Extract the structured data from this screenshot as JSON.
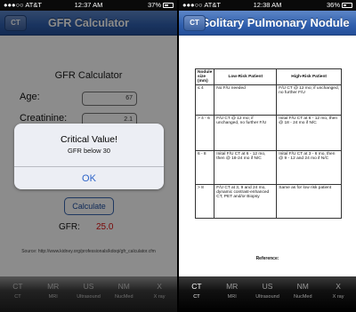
{
  "left": {
    "status": {
      "carrier": "●●●○○ AT&T",
      "time": "12:37 AM",
      "battery": "37%"
    },
    "nav": {
      "back": "CT",
      "title": "GFR Calculator"
    },
    "calc_title": "GFR Calculator",
    "age": {
      "label": "Age:",
      "value": "67"
    },
    "creatinine": {
      "label": "Creatinine:",
      "value": "2.1"
    },
    "calculate_button": "Calculate",
    "gfr": {
      "label": "GFR:",
      "value": "25.0"
    },
    "source": "Source: http://www.kidney.org/professionals/kdoqi/gfr_calculator.cfm",
    "alert": {
      "title": "Critical Value!",
      "message": "GFR below 30",
      "button": "OK"
    },
    "tabs": [
      {
        "abbr": "CT",
        "full": "CT"
      },
      {
        "abbr": "MR",
        "full": "MRI"
      },
      {
        "abbr": "US",
        "full": "Ultrasound"
      },
      {
        "abbr": "NM",
        "full": "NucMed"
      },
      {
        "abbr": "X",
        "full": "X ray"
      }
    ]
  },
  "right": {
    "status": {
      "carrier": "●●●○○ AT&T",
      "time": "12:38 AM",
      "battery": "36%"
    },
    "nav": {
      "back": "CT",
      "title": "Solitary Pulmonary Nodule"
    },
    "table": {
      "headers": [
        "Nodule size (mm)",
        "Low-Risk Patient",
        "High-Risk Patient"
      ],
      "rows": [
        [
          "≤ 4",
          "No F/U needed",
          "F/U CT @ 12 mo; if unchanged, no further F/U"
        ],
        [
          "> 4 - 6",
          "F/U CT @ 12 mo; if unchanged, no further F/U",
          "Inital F/U CT at 6 - 12 mo, then @ 18 - 24 mo if N/C"
        ],
        [
          "6 - 8",
          "Inital F/U CT at 6 - 12 mo, then @ 18-24 mo if N/C",
          "Inital F/U CT at 3 - 6 mo, then @ 9 - 12 and 24 mo if N/C"
        ],
        [
          "> 8",
          "F/U CT at 3, 9 and 24 mo, dynamic contrast-enhanced CT, PET and/or Biopsy",
          "Same as for low risk patient"
        ]
      ]
    },
    "reference": "Reference:",
    "tabs": [
      {
        "abbr": "CT",
        "full": "CT"
      },
      {
        "abbr": "MR",
        "full": "MRI"
      },
      {
        "abbr": "US",
        "full": "Ultrasound"
      },
      {
        "abbr": "NM",
        "full": "NucMed"
      },
      {
        "abbr": "X",
        "full": "X ray"
      }
    ]
  }
}
